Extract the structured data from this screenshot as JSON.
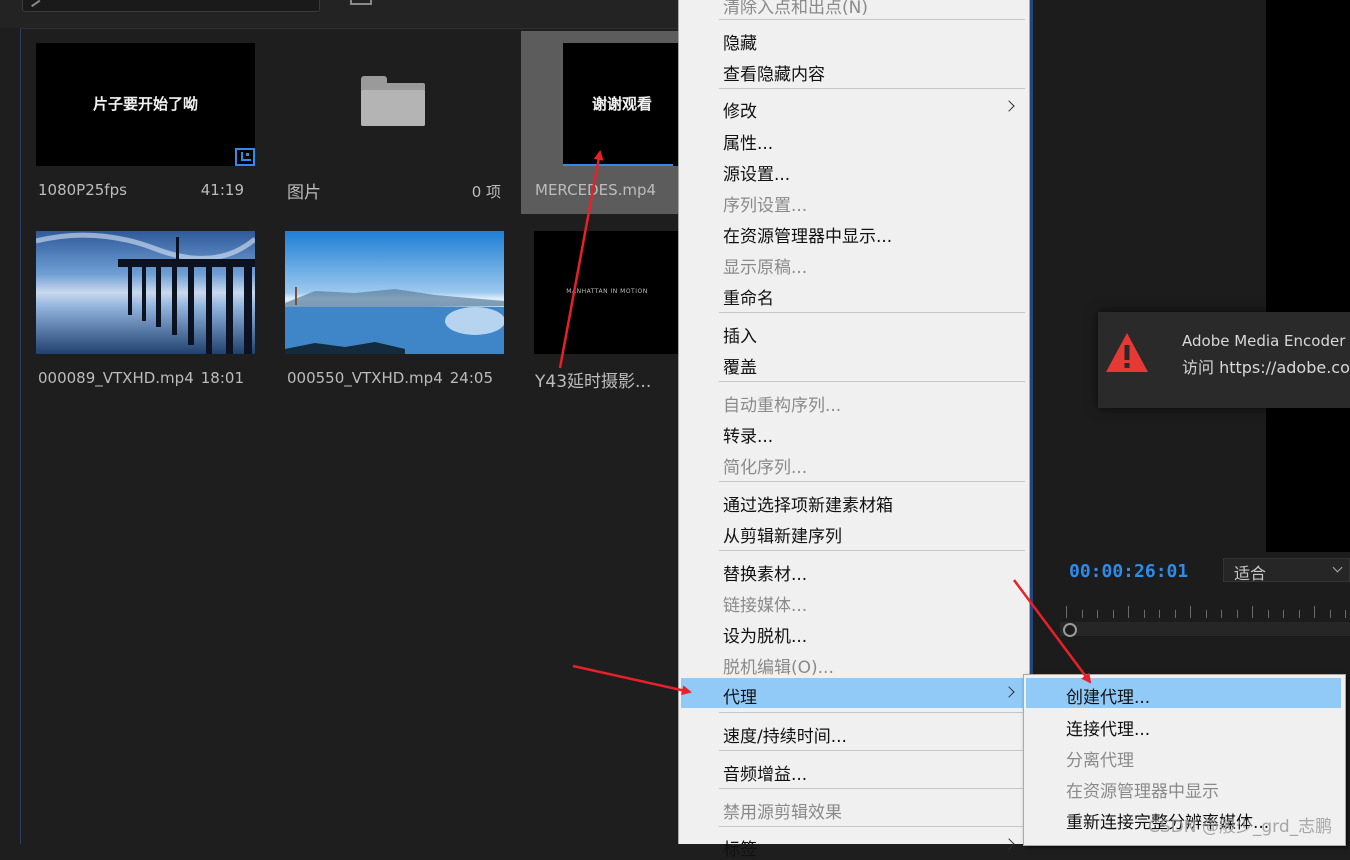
{
  "project_panel": {
    "items": [
      {
        "name": "1080P25fps",
        "meta": "41:19",
        "thumb_text": "片子要开始了呦",
        "type": "sequence"
      },
      {
        "name": "图片",
        "meta": "0 项",
        "type": "bin"
      },
      {
        "name": "MERCEDES.mp4",
        "meta": "",
        "thumb_text": "谢谢观看",
        "type": "clip",
        "selected": true
      },
      {
        "name": "000089_VTXHD.mp4",
        "meta": "18:01",
        "type": "clip",
        "thumb_desc": "pier-at-dusk"
      },
      {
        "name": "000550_VTXHD.mp4",
        "meta": "24:05",
        "type": "clip",
        "thumb_desc": "bay-bridge-aerial"
      },
      {
        "name": "Y43延时摄影...",
        "meta": "",
        "thumb_text": "MANHATTAN IN MOTION",
        "type": "clip"
      }
    ]
  },
  "context_menu": {
    "items": [
      {
        "label": "清除入点和出点(N)",
        "disabled": true
      },
      {
        "label": "隐藏"
      },
      {
        "label": "查看隐藏内容"
      },
      {
        "label": "修改",
        "submenu": true
      },
      {
        "label": "属性..."
      },
      {
        "label": "源设置..."
      },
      {
        "label": "序列设置...",
        "disabled": true
      },
      {
        "label": "在资源管理器中显示..."
      },
      {
        "label": "显示原稿...",
        "disabled": true
      },
      {
        "label": "重命名"
      },
      {
        "label": "插入"
      },
      {
        "label": "覆盖"
      },
      {
        "label": "自动重构序列...",
        "disabled": true
      },
      {
        "label": "转录..."
      },
      {
        "label": "简化序列...",
        "disabled": true
      },
      {
        "label": "通过选择项新建素材箱"
      },
      {
        "label": "从剪辑新建序列"
      },
      {
        "label": "替换素材..."
      },
      {
        "label": "链接媒体...",
        "disabled": true
      },
      {
        "label": "设为脱机..."
      },
      {
        "label": "脱机编辑(O)...",
        "disabled": true
      },
      {
        "label": "代理",
        "submenu": true,
        "highlighted": true
      },
      {
        "label": "速度/持续时间..."
      },
      {
        "label": "音频增益..."
      },
      {
        "label": "禁用源剪辑效果",
        "disabled": true
      },
      {
        "label": "标签",
        "submenu": true
      }
    ]
  },
  "proxy_submenu": {
    "items": [
      {
        "label": "创建代理...",
        "highlighted": true
      },
      {
        "label": "连接代理..."
      },
      {
        "label": "分离代理",
        "disabled": true
      },
      {
        "label": "在资源管理器中显示",
        "disabled": true
      },
      {
        "label": "重新连接完整分辨率媒体..."
      }
    ]
  },
  "program_monitor": {
    "timecode": "00:00:26:01",
    "fit_label": "适合"
  },
  "notification": {
    "title": "Adobe Media Encoder",
    "body": "访问 https://adobe.co",
    "icon": "warning-triangle-icon",
    "icon_color": "#e53935"
  },
  "watermark": "CSDN @般少_grd_志鹏",
  "colors": {
    "accent_blue": "#2d8ceb",
    "menu_highlight": "#91c9f7",
    "annotation_red": "#e8202a"
  }
}
